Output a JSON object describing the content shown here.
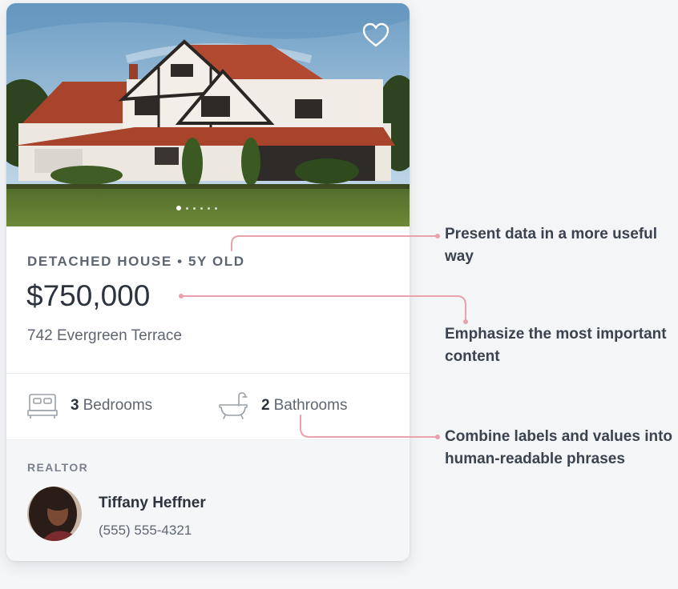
{
  "listing": {
    "category": "DETACHED HOUSE • 5Y OLD",
    "price": "$750,000",
    "address": "742 Evergreen Terrace",
    "bedrooms": {
      "count": "3",
      "label": "Bedrooms"
    },
    "bathrooms": {
      "count": "2",
      "label": "Bathrooms"
    },
    "photo_count": 6,
    "active_photo": 1,
    "favorited": false
  },
  "realtor": {
    "section_label": "REALTOR",
    "name": "Tiffany Heffner",
    "phone": "(555) 555-4321"
  },
  "annotations": [
    {
      "text": "Present data in a more useful way"
    },
    {
      "text": "Emphasize the most important content"
    },
    {
      "text": "Combine labels and values into human-readable phrases"
    }
  ],
  "colors": {
    "accent_annotation": "#e8a1ad",
    "background": "#f4f5f7",
    "card": "#ffffff",
    "realtor_bg": "#f5f6f8"
  },
  "icons": {
    "favorite": "heart-outline-icon",
    "bed": "bed-icon",
    "bath": "bathtub-icon"
  }
}
